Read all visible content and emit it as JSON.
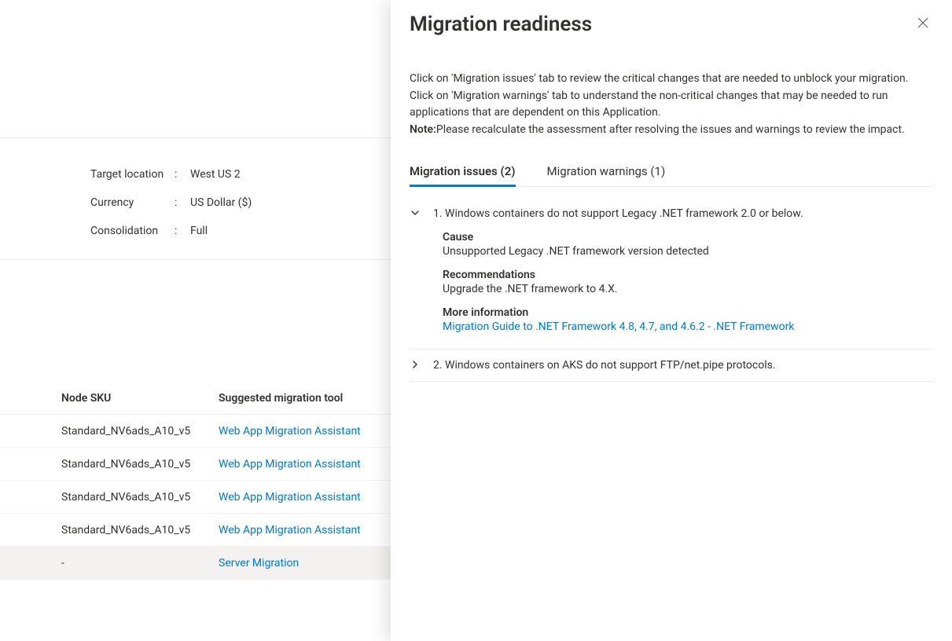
{
  "summary": {
    "target_location_label": "Target location",
    "target_location_value": "West US 2",
    "currency_label": "Currency",
    "currency_value": "US Dollar ($)",
    "consolidation_label": "Consolidation",
    "consolidation_value": "Full"
  },
  "table": {
    "col_sku": "Node SKU",
    "col_tool": "Suggested migration tool",
    "rows": [
      {
        "sku": "Standard_NV6ads_A10_v5",
        "tool": "Web App Migration Assistant"
      },
      {
        "sku": "Standard_NV6ads_A10_v5",
        "tool": "Web App Migration Assistant"
      },
      {
        "sku": "Standard_NV6ads_A10_v5",
        "tool": "Web App Migration Assistant"
      },
      {
        "sku": "Standard_NV6ads_A10_v5",
        "tool": "Web App Migration Assistant"
      },
      {
        "sku": "-",
        "tool": "Server Migration"
      }
    ]
  },
  "panel": {
    "title": "Migration readiness",
    "description": "Click on 'Migration issues' tab to review the critical changes that are needed to unblock your migration. Click on 'Migration warnings' tab to understand the non-critical changes that may be needed to run applications that are dependent on this Application.",
    "note_label": "Note:",
    "note_text": "Please recalculate the assessment after resolving the issues and warnings to review the impact.",
    "tabs": {
      "issues": "Migration issues (2)",
      "warnings": "Migration warnings (1)"
    },
    "issues": [
      {
        "title": "1. Windows containers do not support Legacy .NET framework 2.0 or below.",
        "expanded": true,
        "cause_label": "Cause",
        "cause_text": "Unsupported Legacy .NET framework version detected",
        "rec_label": "Recommendations",
        "rec_text": "Upgrade the .NET framework to 4.X.",
        "more_label": "More information",
        "more_link": "Migration Guide to .NET Framework 4.8, 4.7, and 4.6.2 - .NET Framework"
      },
      {
        "title": "2. Windows containers on AKS do not support FTP/net.pipe protocols.",
        "expanded": false
      }
    ]
  }
}
